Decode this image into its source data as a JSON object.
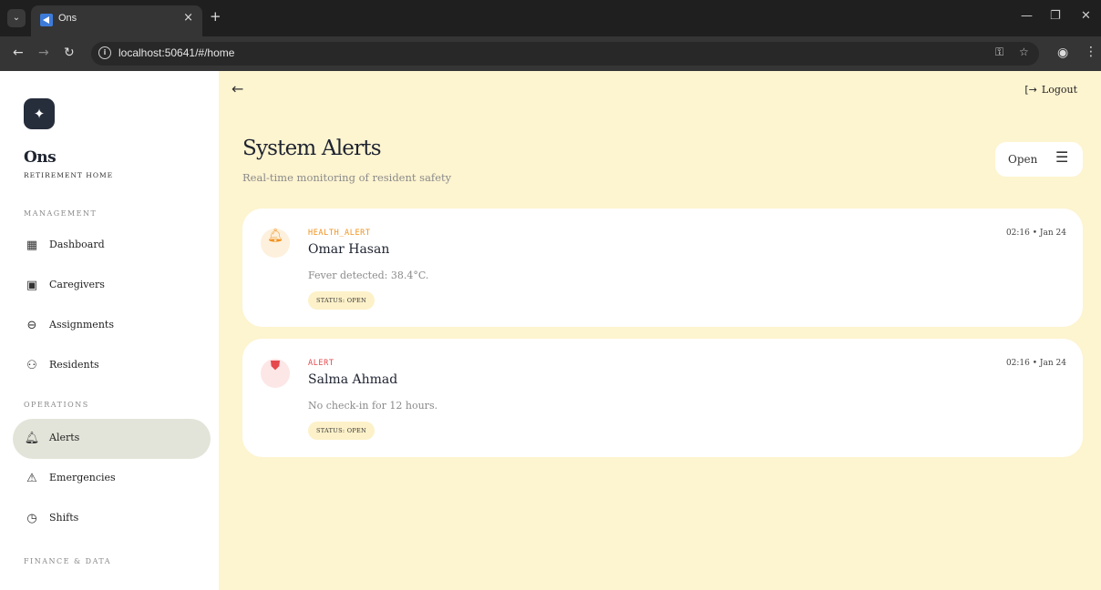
{
  "browser": {
    "tab_title": "Ons",
    "tab_close": "×",
    "new_tab": "+",
    "url": "localhost:50641/#/home"
  },
  "sidebar": {
    "brand": "Ons",
    "brand_sub": "RETIREMENT HOME",
    "sections": {
      "management": "MANAGEMENT",
      "operations": "OPERATIONS",
      "finance": "FINANCE & DATA"
    },
    "items": [
      {
        "label": "Dashboard",
        "icon": "dashboard-icon"
      },
      {
        "label": "Caregivers",
        "icon": "badge-icon"
      },
      {
        "label": "Assignments",
        "icon": "link-icon"
      },
      {
        "label": "Residents",
        "icon": "people-icon"
      },
      {
        "label": "Alerts",
        "icon": "bell-icon",
        "active": true
      },
      {
        "label": "Emergencies",
        "icon": "warning-icon"
      },
      {
        "label": "Shifts",
        "icon": "clock-icon"
      }
    ]
  },
  "header": {
    "logout": "Logout"
  },
  "main": {
    "title": "System Alerts",
    "subtitle": "Real-time monitoring of resident safety",
    "filter_value": "Open"
  },
  "alerts": [
    {
      "type": "HEALTH_ALERT",
      "name": "Omar Hasan",
      "message": "Fever detected: 38.4°C.",
      "status": "STATUS: OPEN",
      "time": "02:16 • Jan 24",
      "color": "#f0921e",
      "icon_bg": "#fdf0dc",
      "icon": "bell-ring-icon"
    },
    {
      "type": "ALERT",
      "name": "Salma Ahmad",
      "message": "No check-in for 12 hours.",
      "status": "STATUS: OPEN",
      "time": "02:16 • Jan 24",
      "color": "#e5484d",
      "icon_bg": "#fde6e6",
      "icon": "shield-alert-icon"
    }
  ],
  "colors": {
    "main_bg": "#fdf4d0",
    "active_nav": "#e3e4d9",
    "browser_dark": "#1f1f1f"
  }
}
